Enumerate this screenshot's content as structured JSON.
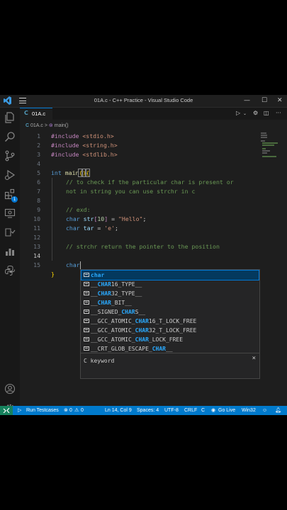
{
  "window": {
    "title": "01A.c - C++ Practice - Visual Studio Code"
  },
  "tab": {
    "filename": "01A.c",
    "lang_icon": "C"
  },
  "breadcrumb": {
    "file": "01A.c",
    "separator": ">",
    "symbol": "main()"
  },
  "editor": {
    "active_line": 14,
    "lines": [
      {
        "num": "1"
      },
      {
        "num": "2"
      },
      {
        "num": "3"
      },
      {
        "num": "4"
      },
      {
        "num": "5"
      },
      {
        "num": "6"
      },
      {
        "num": "7"
      },
      {
        "num": "8"
      },
      {
        "num": "9"
      },
      {
        "num": "10"
      },
      {
        "num": "11"
      },
      {
        "num": "12"
      },
      {
        "num": "13"
      },
      {
        "num": "14"
      },
      {
        "num": "15"
      }
    ],
    "code": {
      "l1_kw": "#include",
      "l1_arg": " <stdio.h>",
      "l2_kw": "#include",
      "l2_arg": " <string.h>",
      "l3_kw": "#include",
      "l3_arg": " <stdlib.h>",
      "l5_type": "int",
      "l5_fn": " main",
      "l5_p1": "(",
      "l5_p2": ")",
      "l5_b": "{",
      "l6": "// to check if the particular char is present or",
      "l7": "not in string you can use strchr in c",
      "l8": "// exd:",
      "l9_type": "char",
      "l9_var": " str",
      "l9_b1": "[",
      "l9_num": "10",
      "l9_b2": "]",
      "l9_eq": " = ",
      "l9_str": "\"Hello\"",
      "l9_end": ";",
      "l10_type": "char",
      "l10_var": " tar",
      "l10_eq": " = ",
      "l10_str": "'e'",
      "l10_end": ";",
      "l12": "// strchr return the pointer to the position",
      "l14": "char",
      "l15": "}"
    }
  },
  "suggestions": {
    "items": [
      {
        "pre": "",
        "match": "char",
        "post": ""
      },
      {
        "pre": "__",
        "match": "CHAR",
        "post": "16_TYPE__"
      },
      {
        "pre": "__",
        "match": "CHAR",
        "post": "32_TYPE__"
      },
      {
        "pre": "__",
        "match": "CHAR",
        "post": "_BIT__"
      },
      {
        "pre": "__SIGNED_",
        "match": "CHAR",
        "post": "S__"
      },
      {
        "pre": "__GCC_ATOMIC_",
        "match": "CHAR",
        "post": "16_T_LOCK_FREE"
      },
      {
        "pre": "__GCC_ATOMIC_",
        "match": "CHAR",
        "post": "32_T_LOCK_FREE"
      },
      {
        "pre": "__GCC_ATOMIC_",
        "match": "CHAR",
        "post": "_LOCK_FREE"
      },
      {
        "pre": "__CRT_GLOB_ESCAPE_",
        "match": "CHAR",
        "post": "__"
      }
    ],
    "detail": "C keyword",
    "close": "×"
  },
  "activity": {
    "extensions_badge": "1"
  },
  "statusbar": {
    "run_testcases": "Run Testcases",
    "errors": "0",
    "warnings": "0",
    "position": "Ln 14, Col 9",
    "spaces": "Spaces: 4",
    "encoding": "UTF-8",
    "eol": "CRLF",
    "language": "C",
    "golive": "Go Live",
    "platform": "Win32"
  },
  "colors": {
    "accent": "#007acc",
    "remote": "#16825d",
    "background": "#1e1e1e"
  }
}
